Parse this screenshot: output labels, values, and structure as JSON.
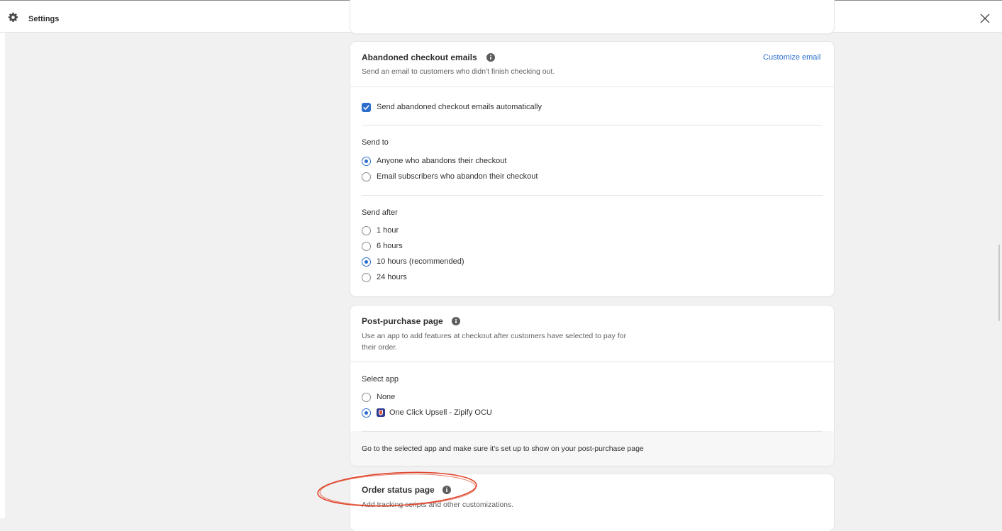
{
  "header": {
    "title": "Settings",
    "settings_icon": "gear-icon",
    "close_icon": "close-icon"
  },
  "abandoned": {
    "title": "Abandoned checkout emails",
    "info_icon": "info-icon",
    "customize_link": "Customize email",
    "subtitle": "Send an email to customers who didn't finish checking out.",
    "checkbox_label": "Send abandoned checkout emails automatically",
    "checkbox_checked": true,
    "send_to": {
      "label": "Send to",
      "options": [
        {
          "label": "Anyone who abandons their checkout",
          "checked": true
        },
        {
          "label": "Email subscribers who abandon their checkout",
          "checked": false
        }
      ]
    },
    "send_after": {
      "label": "Send after",
      "options": [
        {
          "label": "1 hour",
          "checked": false
        },
        {
          "label": "6 hours",
          "checked": false
        },
        {
          "label": "10 hours (recommended)",
          "checked": true
        },
        {
          "label": "24 hours",
          "checked": false
        }
      ]
    }
  },
  "post_purchase": {
    "title": "Post-purchase page",
    "info_icon": "info-icon",
    "subtitle_line1": "Use an app to add features at checkout after customers have selected to pay for",
    "subtitle_line2": "their order.",
    "select_label": "Select app",
    "options": [
      {
        "label": "None",
        "checked": false
      },
      {
        "label": "One Click Upsell - Zipify OCU",
        "checked": true,
        "icon": "zipify-app-icon"
      }
    ],
    "footer_text": "Go to the selected app and make sure it's set up to show on your post-purchase page"
  },
  "order_status": {
    "title": "Order status page",
    "info_icon": "info-icon",
    "subtitle": "Add tracking scripts and other customizations."
  },
  "colors": {
    "accent": "#2c6ecb",
    "annotation": "#e0442a"
  }
}
